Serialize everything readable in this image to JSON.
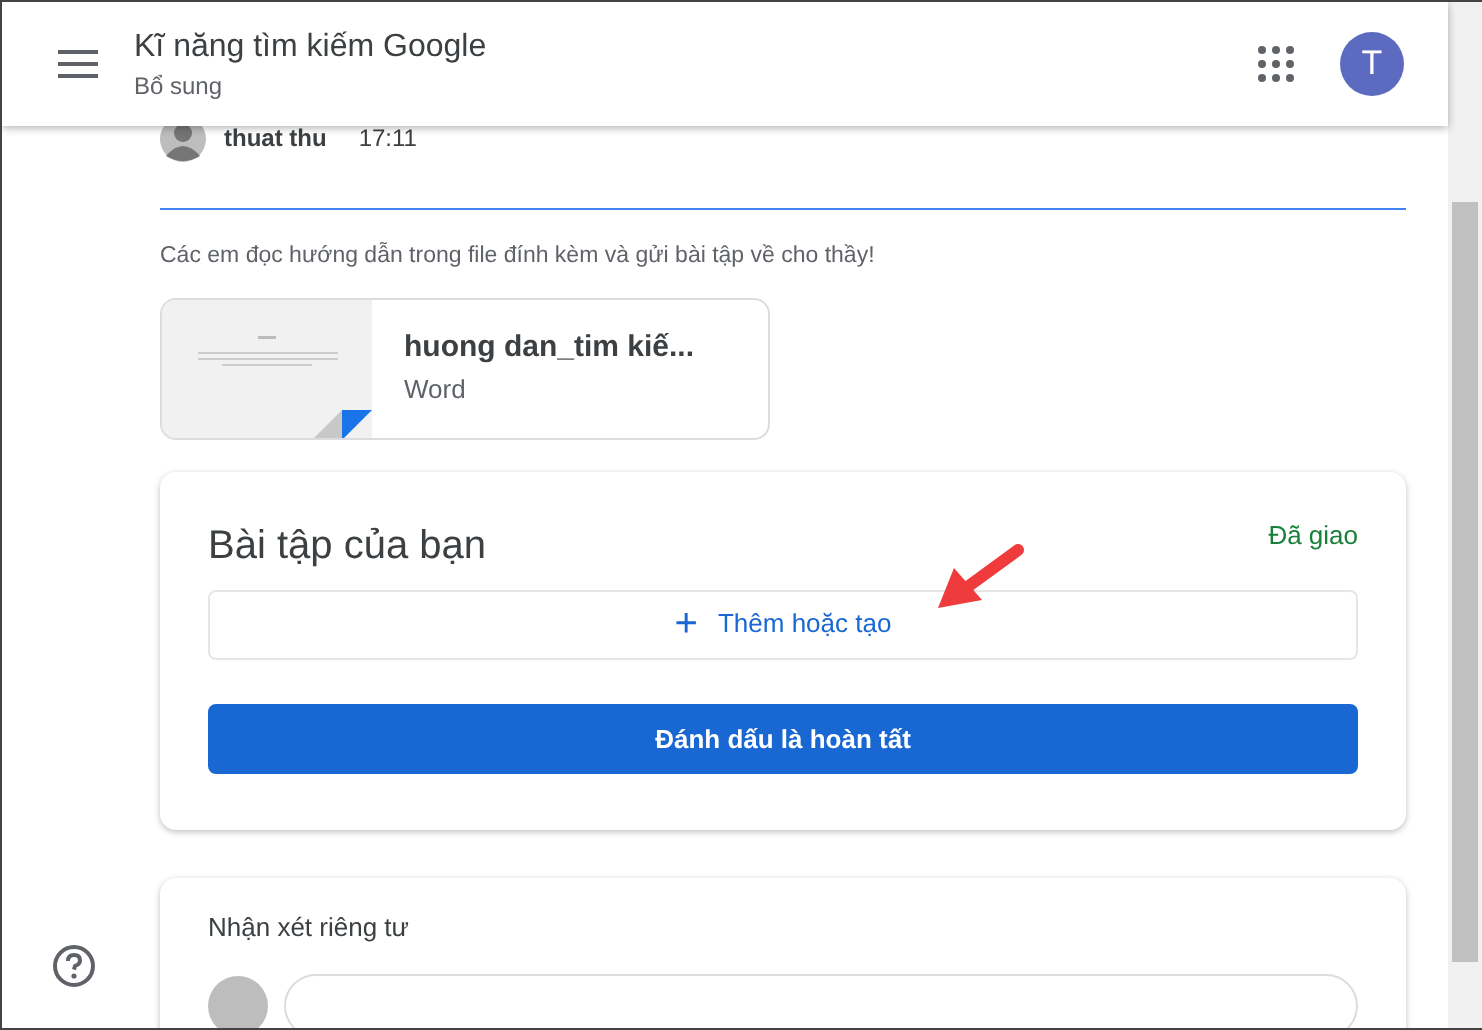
{
  "header": {
    "title": "Kĩ năng tìm kiếm Google",
    "subtitle": "Bổ sung",
    "avatar_letter": "T"
  },
  "post": {
    "author": "thuat thu",
    "time": "17:11",
    "text": "Các em đọc hướng dẫn trong file đính kèm và gửi bài tập về cho thầy!"
  },
  "attachment": {
    "name": "huong dan_tim kiế...",
    "type": "Word"
  },
  "assignment": {
    "title": "Bài tập của bạn",
    "status": "Đã giao",
    "add_button": "Thêm hoặc tạo",
    "add_icon": "+",
    "done_button": "Đánh dấu là hoàn tất"
  },
  "private_comments": {
    "title": "Nhận xét riêng tư"
  }
}
